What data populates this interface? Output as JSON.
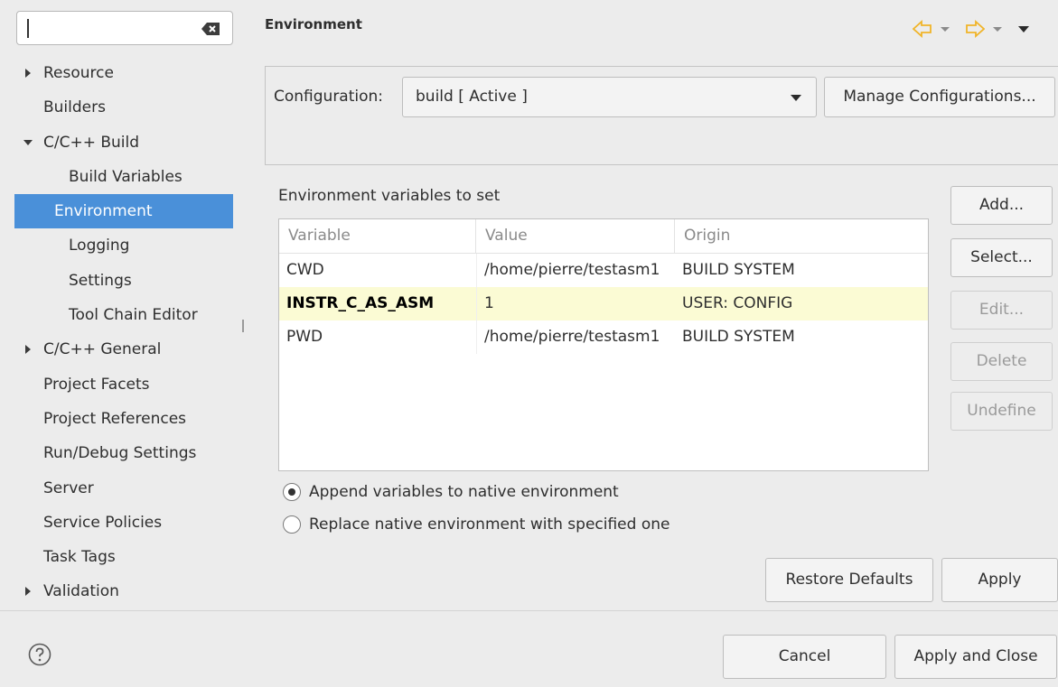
{
  "sidebar": {
    "filter_value": "",
    "items": [
      {
        "label": "Resource",
        "expander": "collapsed"
      },
      {
        "label": "Builders",
        "expander": "none"
      },
      {
        "label": "C/C++ Build",
        "expander": "expanded"
      },
      {
        "label": "Build Variables",
        "expander": "none"
      },
      {
        "label": "Environment",
        "expander": "none",
        "selected": true
      },
      {
        "label": "Logging",
        "expander": "none"
      },
      {
        "label": "Settings",
        "expander": "none"
      },
      {
        "label": "Tool Chain Editor",
        "expander": "none"
      },
      {
        "label": "C/C++ General",
        "expander": "collapsed"
      },
      {
        "label": "Project Facets",
        "expander": "none"
      },
      {
        "label": "Project References",
        "expander": "none"
      },
      {
        "label": "Run/Debug Settings",
        "expander": "none"
      },
      {
        "label": "Server",
        "expander": "none"
      },
      {
        "label": "Service Policies",
        "expander": "none"
      },
      {
        "label": "Task Tags",
        "expander": "none"
      },
      {
        "label": "Validation",
        "expander": "collapsed"
      }
    ]
  },
  "page": {
    "title": "Environment"
  },
  "configuration": {
    "label": "Configuration:",
    "selected": "build  [ Active ]",
    "manage_label": "Manage Configurations..."
  },
  "env": {
    "section_label": "Environment variables to set",
    "columns": [
      "Variable",
      "Value",
      "Origin"
    ],
    "rows": [
      {
        "variable": "CWD",
        "value": "/home/pierre/testasm1",
        "origin": "BUILD SYSTEM",
        "highlighted": false
      },
      {
        "variable": "INSTR_C_AS_ASM",
        "value": "1",
        "origin": "USER: CONFIG",
        "highlighted": true
      },
      {
        "variable": "PWD",
        "value": "/home/pierre/testasm1",
        "origin": "BUILD SYSTEM",
        "highlighted": false
      }
    ],
    "buttons": {
      "add": "Add...",
      "select": "Select...",
      "edit": "Edit...",
      "delete": "Delete",
      "undefine": "Undefine"
    },
    "radio_append": "Append variables to native environment",
    "radio_replace": "Replace native environment with specified one",
    "selected_radio": "append"
  },
  "actions": {
    "restore_defaults": "Restore Defaults",
    "apply": "Apply",
    "cancel": "Cancel",
    "apply_and_close": "Apply and Close"
  },
  "colors": {
    "selection": "#4a90d9",
    "row_highlight": "#fbfbd4",
    "nav_arrow": "#f0b429"
  }
}
